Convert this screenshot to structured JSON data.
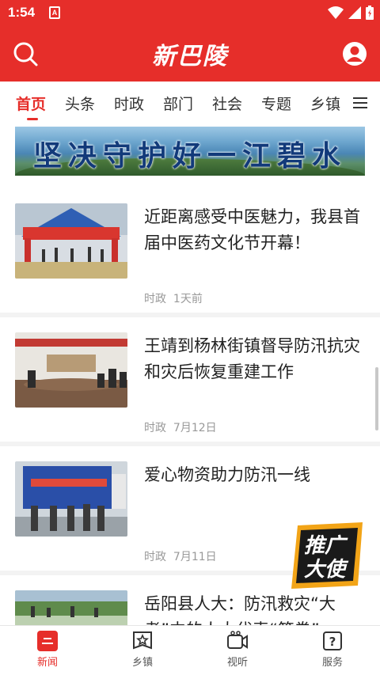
{
  "status_bar": {
    "time": "1:54",
    "notification_badge": "A"
  },
  "app_bar": {
    "logo_text": "新巴陵"
  },
  "tabs": [
    {
      "label": "首页",
      "active": true
    },
    {
      "label": "头条"
    },
    {
      "label": "时政"
    },
    {
      "label": "部门"
    },
    {
      "label": "社会"
    },
    {
      "label": "专题"
    },
    {
      "label": "乡镇"
    }
  ],
  "banner": {
    "text": "坚决守护好一江碧水"
  },
  "news": [
    {
      "title": "近距离感受中医魅力，我县首届中医药文化节开幕！",
      "category": "时政",
      "time": "1天前"
    },
    {
      "title": "王靖到杨林街镇督导防汛抗灾和灾后恢复重建工作",
      "category": "时政",
      "time": "7月12日"
    },
    {
      "title": "爱心物资助力防汛一线",
      "category": "时政",
      "time": "7月11日"
    },
    {
      "title": "岳阳县人大：防汛救灾“大考”中的人大代表“答卷”",
      "category": "",
      "time": ""
    }
  ],
  "promo": {
    "line1": "推广",
    "line2": "大使"
  },
  "bottom_nav": [
    {
      "label": "新闻",
      "icon": "news-icon",
      "active": true
    },
    {
      "label": "乡镇",
      "icon": "township-icon"
    },
    {
      "label": "视听",
      "icon": "video-icon"
    },
    {
      "label": "服务",
      "icon": "service-icon"
    }
  ],
  "colors": {
    "brand_red": "#e62e2a",
    "meta_gray": "#999999"
  }
}
